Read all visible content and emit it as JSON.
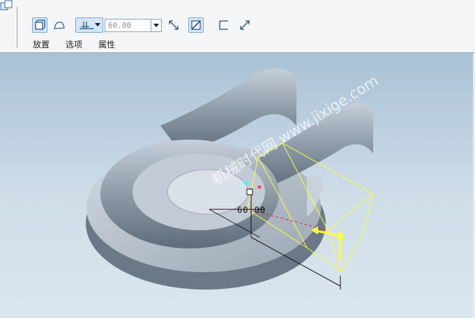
{
  "toolbar": {
    "value": "60.00",
    "tabs": [
      "放置",
      "选项",
      "属性"
    ]
  },
  "viewport": {
    "dimension_label": "60.00",
    "watermark": "机械时代网 www.jixige.com"
  },
  "colors": {
    "selection": "#ffff33",
    "accent": "#7fa6cc"
  }
}
